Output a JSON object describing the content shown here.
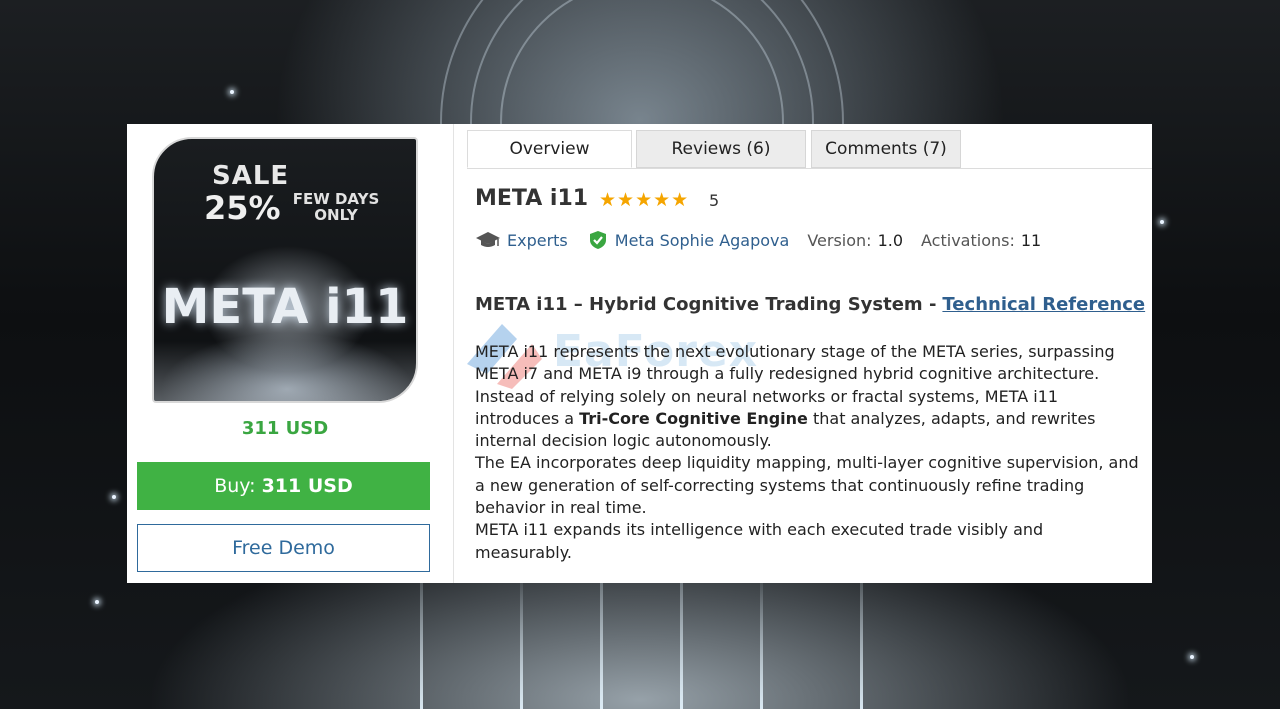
{
  "product": {
    "image_text": {
      "sale": "SALE",
      "percent": "25%",
      "few_days": "FEW DAYS ONLY",
      "name": "META i11"
    },
    "price": "311 USD",
    "buy_label": "Buy:",
    "buy_price": "311 USD",
    "demo_label": "Free Demo"
  },
  "tabs": [
    {
      "label": "Overview",
      "active": true
    },
    {
      "label": "Reviews (6)",
      "active": false
    },
    {
      "label": "Comments (7)",
      "active": false
    }
  ],
  "header": {
    "title": "META i11",
    "stars": "★★★★★",
    "rating": "5",
    "category": "Experts",
    "author": "Meta Sophie Agapova",
    "version_label": "Version:",
    "version": "1.0",
    "activations_label": "Activations:",
    "activations": "11"
  },
  "description": {
    "heading": "META i11 – Hybrid Cognitive Trading System -",
    "heading_link": "Technical Reference",
    "p1_a": "META i11 represents the next evolutionary stage of the META series, surpassing META i7 and META i9 through a fully redesigned hybrid cognitive architecture. Instead of relying solely on neural networks or fractal systems, META i11 introduces a ",
    "p1_bold": "Tri-Core Cognitive Engine",
    "p1_b": " that analyzes, adapts, and rewrites internal decision logic autonomously.",
    "p2": "The EA incorporates deep liquidity mapping, multi-layer cognitive supervision, and a new generation of self-correcting systems that continuously refine trading behavior in real time.",
    "p3": "META i11 expands its intelligence with each executed trade visibly and measurably."
  },
  "watermark": "EaForex",
  "colors": {
    "price_green": "#3aa641",
    "buy_button": "#40b244",
    "link_blue": "#2f5f8e",
    "star_gold": "#f5a500"
  }
}
